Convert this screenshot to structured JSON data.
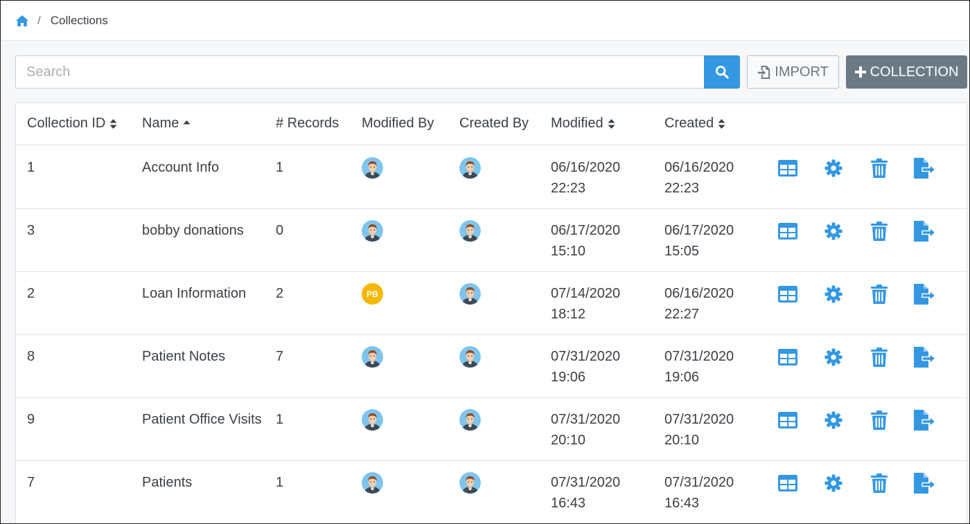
{
  "breadcrumb": {
    "home_icon": "home-icon",
    "separator": "/",
    "current": "Collections"
  },
  "toolbar": {
    "search_placeholder": "Search",
    "search_value": "",
    "import_label": "IMPORT",
    "add_collection_label": "COLLECTION"
  },
  "colors": {
    "accent": "#3397e2",
    "secondary_button": "#6c7a86",
    "avatar_pb": "#f5b800"
  },
  "table": {
    "columns": [
      {
        "label": "Collection ID",
        "sort": "both"
      },
      {
        "label": "Name",
        "sort": "asc"
      },
      {
        "label": "# Records",
        "sort": "none"
      },
      {
        "label": "Modified By",
        "sort": "none"
      },
      {
        "label": "Created By",
        "sort": "none"
      },
      {
        "label": "Modified",
        "sort": "both"
      },
      {
        "label": "Created",
        "sort": "both"
      }
    ],
    "rows": [
      {
        "id": "1",
        "name": "Account Info",
        "records": "1",
        "modified_by": "avatar",
        "created_by": "avatar",
        "modified_date": "06/16/2020",
        "modified_time": "22:23",
        "created_date": "06/16/2020",
        "created_time": "22:23"
      },
      {
        "id": "3",
        "name": "bobby donations",
        "records": "0",
        "modified_by": "avatar",
        "created_by": "avatar",
        "modified_date": "06/17/2020",
        "modified_time": "15:10",
        "created_date": "06/17/2020",
        "created_time": "15:05"
      },
      {
        "id": "2",
        "name": "Loan Information",
        "records": "2",
        "modified_by": "PB",
        "created_by": "avatar",
        "modified_date": "07/14/2020",
        "modified_time": "18:12",
        "created_date": "06/16/2020",
        "created_time": "22:27"
      },
      {
        "id": "8",
        "name": "Patient Notes",
        "records": "7",
        "modified_by": "avatar",
        "created_by": "avatar",
        "modified_date": "07/31/2020",
        "modified_time": "19:06",
        "created_date": "07/31/2020",
        "created_time": "19:06"
      },
      {
        "id": "9",
        "name": "Patient Office Visits",
        "records": "1",
        "modified_by": "avatar",
        "created_by": "avatar",
        "modified_date": "07/31/2020",
        "modified_time": "20:10",
        "created_date": "07/31/2020",
        "created_time": "20:10"
      },
      {
        "id": "7",
        "name": "Patients",
        "records": "1",
        "modified_by": "avatar",
        "created_by": "avatar",
        "modified_date": "07/31/2020",
        "modified_time": "16:43",
        "created_date": "07/31/2020",
        "created_time": "16:43"
      }
    ],
    "row_actions": [
      "table-view-icon",
      "gear-icon",
      "trash-icon",
      "export-icon"
    ]
  }
}
